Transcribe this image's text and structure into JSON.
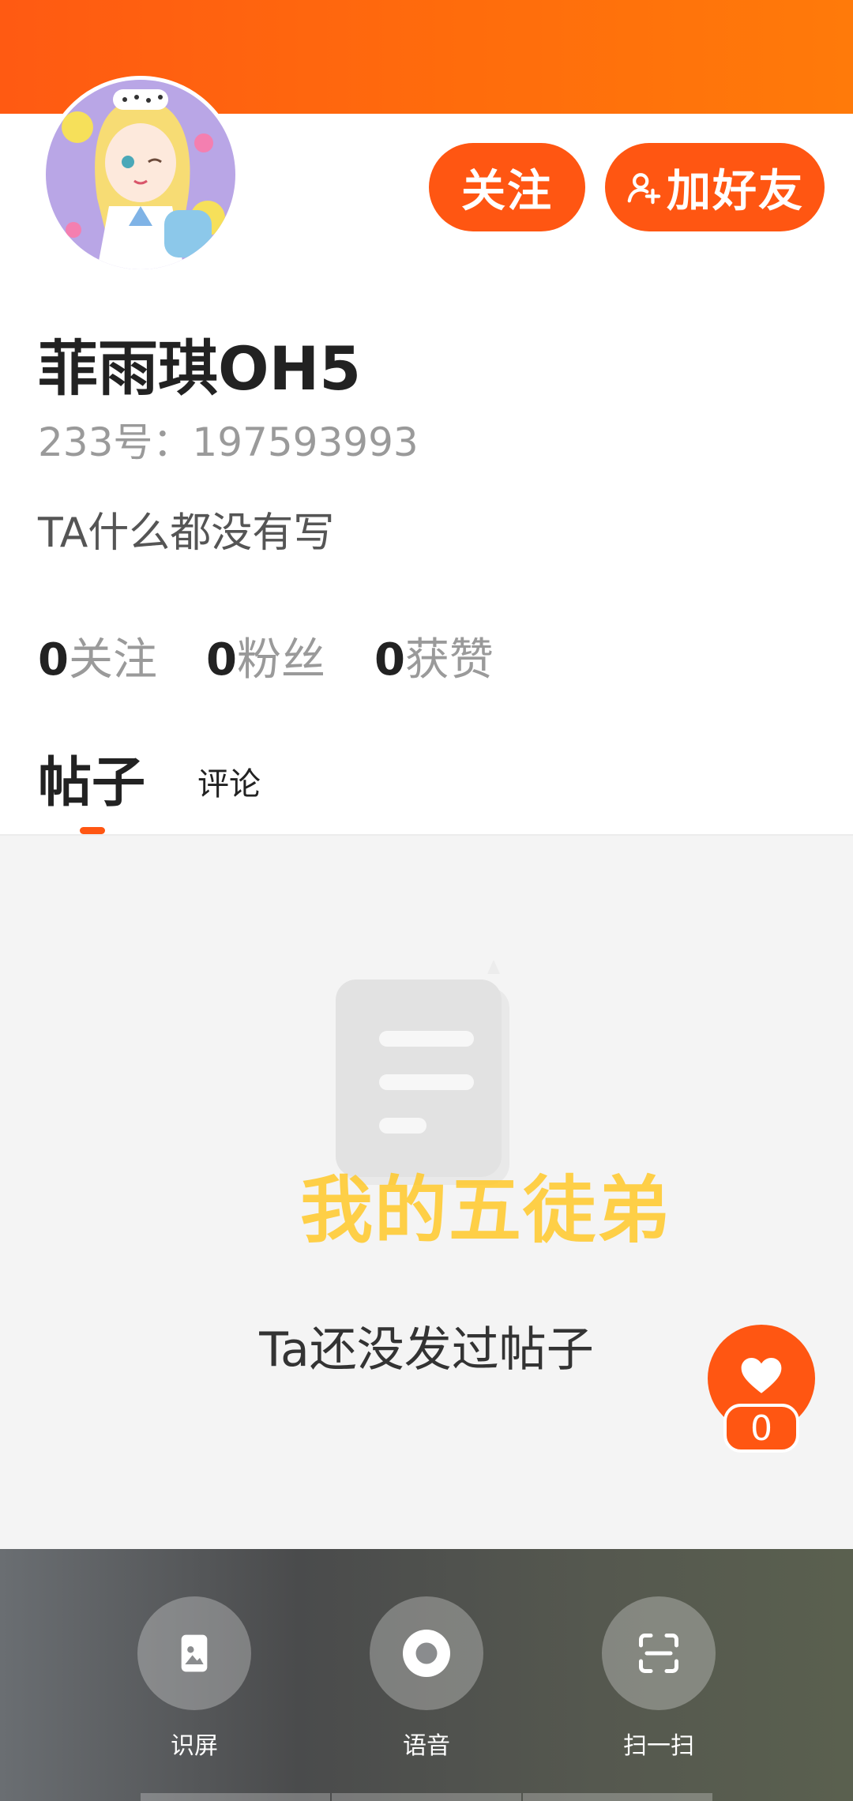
{
  "profile": {
    "name": "菲雨琪OH5",
    "id_text": "233号：197593993",
    "bio": "TA什么都没有写"
  },
  "actions": {
    "follow_label": "关注",
    "add_friend_label": "加好友"
  },
  "stats": [
    {
      "value": "0",
      "label": "关注"
    },
    {
      "value": "0",
      "label": "粉丝"
    },
    {
      "value": "0",
      "label": "获赞"
    }
  ],
  "tabs": [
    {
      "label": "帖子",
      "active": true
    },
    {
      "label": "评论",
      "active": false
    }
  ],
  "empty_state": {
    "overlay_text": "我的五徒弟",
    "message": "Ta还没发过帖子"
  },
  "like_fab": {
    "count": "0"
  },
  "assistant_bar": {
    "items": [
      {
        "label": "识屏",
        "icon": "image-phone-icon"
      },
      {
        "label": "语音",
        "icon": "voice-icon"
      },
      {
        "label": "扫一扫",
        "icon": "scan-icon"
      }
    ]
  },
  "colors": {
    "accent": "#ff5612",
    "header_gradient_start": "#ff5a12",
    "header_gradient_end": "#ff7a0a",
    "watermark": "#ffc828"
  }
}
